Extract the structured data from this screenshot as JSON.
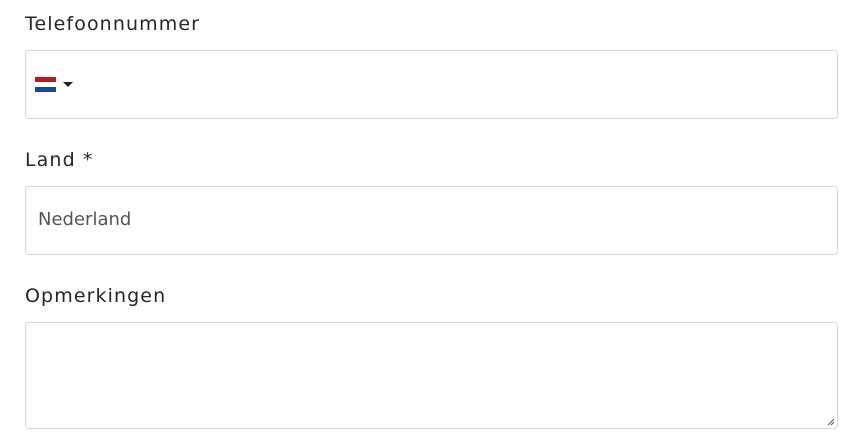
{
  "form": {
    "phone": {
      "label": "Telefoonnummer",
      "value": "",
      "country_flag_icon": "flag-nl-icon",
      "flag_colors": [
        "#ae1c28",
        "#ffffff",
        "#21468b"
      ]
    },
    "country": {
      "label": "Land *",
      "value": "Nederland"
    },
    "notes": {
      "label": "Opmerkingen",
      "value": ""
    }
  }
}
